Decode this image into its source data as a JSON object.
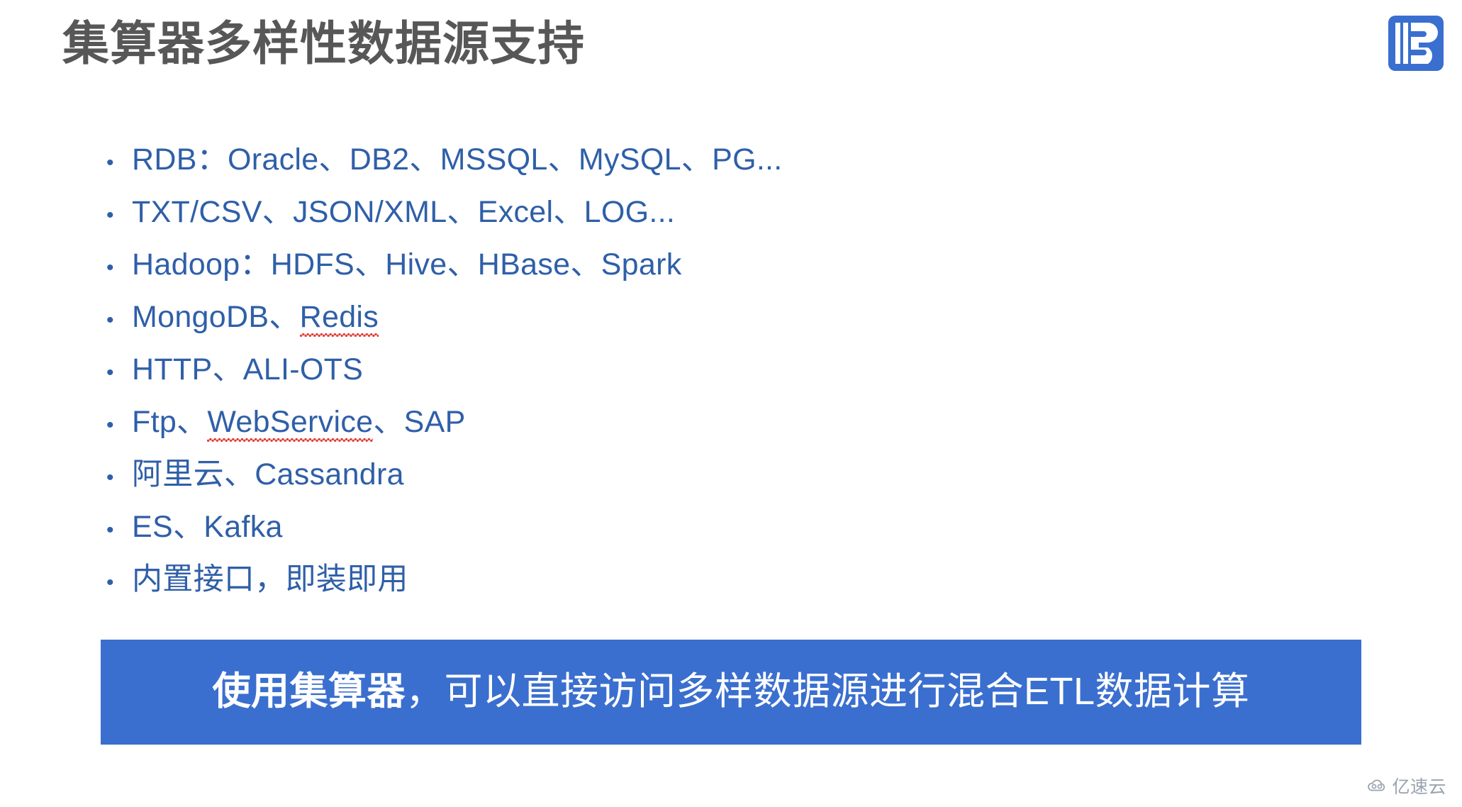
{
  "slide": {
    "title": "集算器多样性数据源支持",
    "title_color": "#575757",
    "accent_blue": "#2f5fa8",
    "banner_blue": "#3a6fcf"
  },
  "logo": {
    "name": "raqsoft-logo",
    "color": "#3a6fcf",
    "letter": "R"
  },
  "bullets": [
    {
      "dot": "•",
      "segments": [
        {
          "text": "RDB：Oracle、DB2、MSSQL、MySQL、PG...",
          "style": "plain"
        }
      ]
    },
    {
      "dot": "•",
      "segments": [
        {
          "text": "TXT/CSV、JSON/XML、Excel、LOG...",
          "style": "plain"
        }
      ]
    },
    {
      "dot": "•",
      "segments": [
        {
          "text": "Hadoop：HDFS、Hive、HBase、Spark",
          "style": "plain"
        }
      ]
    },
    {
      "dot": "•",
      "segments": [
        {
          "text": "MongoDB、",
          "style": "plain"
        },
        {
          "text": "Redis",
          "style": "misspelled"
        }
      ]
    },
    {
      "dot": "•",
      "segments": [
        {
          "text": "HTTP、ALI-OTS",
          "style": "plain"
        }
      ]
    },
    {
      "dot": "•",
      "segments": [
        {
          "text": "Ftp、",
          "style": "plain"
        },
        {
          "text": "WebService",
          "style": "misspelled"
        },
        {
          "text": "、SAP",
          "style": "plain"
        }
      ]
    },
    {
      "dot": "•",
      "segments": [
        {
          "text": "阿里云、Cassandra",
          "style": "plain"
        }
      ]
    },
    {
      "dot": "•",
      "segments": [
        {
          "text": "ES、Kafka",
          "style": "plain"
        }
      ]
    },
    {
      "dot": "•",
      "segments": [
        {
          "text": "内置接口，即装即用",
          "style": "plain"
        }
      ]
    }
  ],
  "banner": {
    "bold_text": "使用集算器",
    "rest_text": "，可以直接访问多样数据源进行混合ETL数据计算"
  },
  "watermark": {
    "text": "亿速云",
    "icon": "cloud-icon"
  }
}
